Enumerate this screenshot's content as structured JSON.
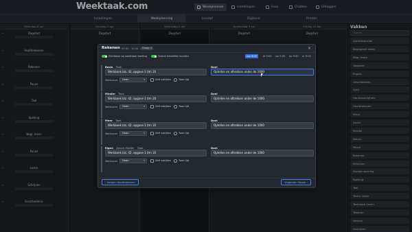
{
  "app": {
    "logo": "Weektaak.com"
  },
  "topnav": [
    {
      "label": "Weekplannen",
      "icon": "calendar-icon",
      "active": true
    },
    {
      "label": "Instellingen",
      "icon": "gear-icon"
    },
    {
      "label": "Hulp",
      "icon": "help-icon"
    },
    {
      "label": "Chatten",
      "icon": "chat-icon"
    },
    {
      "label": "Uitloggen",
      "icon": "logout-icon"
    }
  ],
  "subtabs": [
    {
      "label": "Instellingen",
      "active": false
    },
    {
      "label": "Weekplanning",
      "active": true
    },
    {
      "label": "Lesstof",
      "active": false
    },
    {
      "label": "Digibord",
      "active": false
    },
    {
      "label": "Printen",
      "active": false
    }
  ],
  "days": [
    "Maandag 6 apr",
    "Dinsdag 7 apr",
    "Woensdag 8 apr",
    "Donderdag 9 apr",
    "Vrijdag 10 apr"
  ],
  "day_slots": [
    "Dagstart",
    "Hoofdrekenen",
    "Rekenen",
    "Pauze",
    "Taal",
    "Spelling",
    "Begr. lezen",
    "Pauze",
    "Lezen",
    "Schrijven",
    "Geschiedenis"
  ],
  "sidebar": {
    "title": "Vakken",
    "search_placeholder": "Zoeken...",
    "items": [
      "Aardrijkskunde",
      "Begrijpend lezen",
      "Begr. lezen",
      "Dagstart",
      "Engels",
      "Geschiedenis",
      "Gym",
      "Handvaardigheid",
      "Hoofdrekenen",
      "Kring",
      "Lezen",
      "Muziek",
      "Natuur",
      "Pauze",
      "Rekenen",
      "Schrijven",
      "Sociale vorming",
      "Spelling",
      "Taal",
      "Techn. lezen",
      "Technisch Lezen",
      "Tekenen",
      "Verkeer",
      "Voorlezen"
    ]
  },
  "modal": {
    "title": "Rekenen",
    "time": "09:00 - 10:00",
    "group": "Groep 4",
    "toggle1": "Zichtbaar op weektaak leerling",
    "toggle2": "Overal hetzelfde invullen",
    "times": [
      "ma 9:00",
      "di 9:00",
      "wo 9:00",
      "do 9:00",
      "vr 9:00"
    ],
    "close": "×",
    "taak_label": "Taak",
    "doel_label": "Doel",
    "werkvorm_label": "Werkvorm",
    "werkvorm_value": "Geen",
    "check1": "Zelf nakijken",
    "check2": "Toon tijd",
    "sections": [
      {
        "level": "Basis",
        "sub": "",
        "taak": "Werkboek blz. 42, opgave 1 t/m 20",
        "doel": "Optellen en aftrekken onder de 1000"
      },
      {
        "level": "Minder",
        "sub": "",
        "taak": "Werkboek blz. 42, opgave 1 t/m 20",
        "doel": "Optellen en aftrekken onder de 1000"
      },
      {
        "level": "Meer",
        "sub": "",
        "taak": "Werkboek blz. 42, opgave 1 t/m 20",
        "doel": "Optellen en aftrekken onder de 1000"
      },
      {
        "level": "Eigen",
        "sub": "Anouk Mulder",
        "taak": "Werkboek blz. 42, opgave 1 t/m 20",
        "doel": "Optellen en aftrekken onder de 1000"
      }
    ],
    "prev_button": "‹  Vorige: Hoofdrekenen",
    "next_button": "Volgende: Pauze  ›"
  },
  "colors": {
    "accent": "#3b82f6",
    "toggle_on": "#3fb950",
    "bg": "#1b1f24"
  }
}
